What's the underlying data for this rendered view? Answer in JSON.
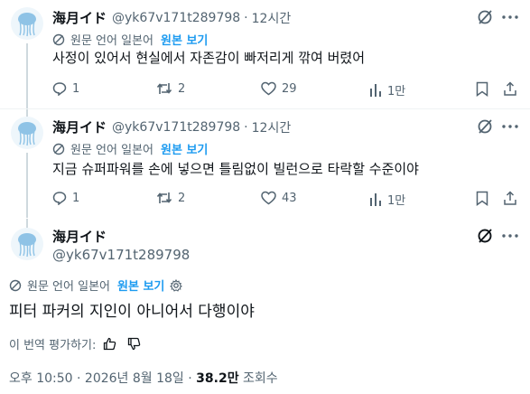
{
  "replies": [
    {
      "name": "海月イド",
      "handle": "@yk67v171t289798",
      "sep": "·",
      "time": "12시간",
      "translation_note": "원문 언어 일본어",
      "show_original": "원본 보기",
      "text": "사정이 있어서 현실에서 자존감이 빠저리게 깎여 버렸어",
      "reply_count": "1",
      "retweet_count": "2",
      "like_count": "29",
      "view_count": "1만"
    },
    {
      "name": "海月イド",
      "handle": "@yk67v171t289798",
      "sep": "·",
      "time": "12시간",
      "translation_note": "원문 언어 일본어",
      "show_original": "원본 보기",
      "text": "지금 슈퍼파워를 손에 넣으면 틀림없이 빌런으로 타락할 수준이야",
      "reply_count": "1",
      "retweet_count": "2",
      "like_count": "43",
      "view_count": "1만"
    }
  ],
  "main": {
    "name": "海月イド",
    "handle": "@yk67v171t289798",
    "translation_note": "원문 언어 일본어",
    "show_original": "원본 보기",
    "text": "피터 파커의 지인이 아니어서 다행이야",
    "rate_translation": "이 번역 평가하기:",
    "timestamp": "오후 10:50 · 2026년 8월 18일 · ",
    "views_number": "38.2만",
    "views_label": " 조회수"
  },
  "icons": {
    "translate": "translate-icon",
    "no_translate": "no-translate-icon",
    "reply": "reply-icon",
    "retweet": "retweet-icon",
    "like": "like-icon",
    "views": "views-icon",
    "settings": "gear-icon",
    "thumbs_up": "thumbs-up-icon",
    "thumbs_down": "thumbs-down-icon"
  },
  "colors": {
    "link": "#1d9bf0",
    "secondary_text": "#536471",
    "primary_text": "#0f1419"
  }
}
